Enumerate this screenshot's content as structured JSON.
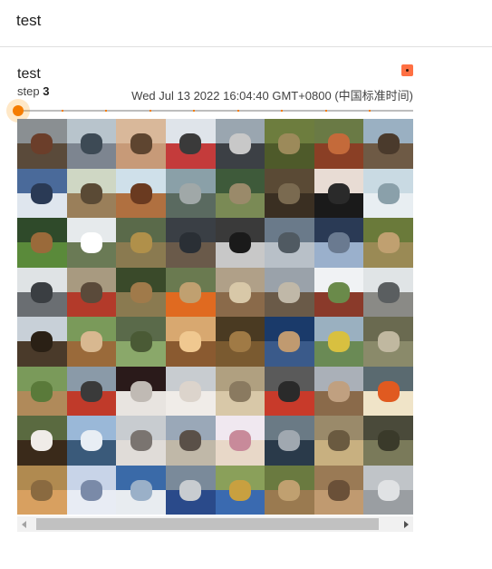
{
  "header": {
    "title": "test"
  },
  "card": {
    "title": "test",
    "step_label": "step",
    "step_value": "3",
    "timestamp": "Wed Jul 13 2022 16:04:40 GMT+0800 (中国标准时间)",
    "expand_icon": "expand-icon",
    "accent_color": "#ff7043"
  },
  "slider": {
    "value_fraction": 0.0,
    "thumb_color": "#f57c00",
    "ticks": 8
  },
  "image_grid": {
    "rows": 8,
    "cols": 8,
    "tiles": [
      [
        "#8a8f92",
        "#5a4a3a",
        "#6b3e2a"
      ],
      [
        "#b8c4cc",
        "#7d8590",
        "#3d4a55"
      ],
      [
        "#d9b89a",
        "#c79a78",
        "#5e4530"
      ],
      [
        "#dfe4ea",
        "#c43b3b",
        "#3a3a3a"
      ],
      [
        "#9aa6b0",
        "#3c4045",
        "#c8c8c8"
      ],
      [
        "#6d7d3e",
        "#4e5a2a",
        "#9c8a5a"
      ],
      [
        "#6a7a45",
        "#8a3f25",
        "#c46a3a"
      ],
      [
        "#9ab0c2",
        "#6e5a45",
        "#4a3a2c"
      ],
      [
        "#4a6a9a",
        "#dfe6ee",
        "#2a3a55"
      ],
      [
        "#cfd7c4",
        "#9a7f5a",
        "#5a4a35"
      ],
      [
        "#cfe0ea",
        "#b07040",
        "#6a3a20"
      ],
      [
        "#8aa0a8",
        "#5a6a60",
        "#a0a8a8"
      ],
      [
        "#3e5a3a",
        "#7a8a55",
        "#9a8a6a"
      ],
      [
        "#5a4a35",
        "#3a2f22",
        "#7a6a50"
      ],
      [
        "#e8dcd4",
        "#1a1a1a",
        "#2a2a2a"
      ],
      [
        "#c9dae3",
        "#e8eef2",
        "#8aa0aa"
      ],
      [
        "#2f4a2a",
        "#5a8a3a",
        "#9a6a3a"
      ],
      [
        "#e6eaec",
        "#6a7a55",
        "#ffffff"
      ],
      [
        "#5a6a4a",
        "#8a7a50",
        "#b0904a"
      ],
      [
        "#3a3f45",
        "#6a5a4a",
        "#2a2f35"
      ],
      [
        "#3a3a3a",
        "#c8c8c8",
        "#1a1a1a"
      ],
      [
        "#6a7a8a",
        "#b8c0c8",
        "#505a62"
      ],
      [
        "#2a3a55",
        "#9ab0cc",
        "#6a7a90"
      ],
      [
        "#6a7a3a",
        "#9a8a55",
        "#c0a070"
      ],
      [
        "#dfe3e5",
        "#6a6e72",
        "#3a3e42"
      ],
      [
        "#a89a80",
        "#b33a2a",
        "#5a4a3a"
      ],
      [
        "#3a4a2a",
        "#8a7a50",
        "#a07a4a"
      ],
      [
        "#6a7a50",
        "#e06a20",
        "#c0a070"
      ],
      [
        "#b0a088",
        "#8a6a4a",
        "#d8c8a8"
      ],
      [
        "#9aa2aa",
        "#6a5a48",
        "#c0b8a8"
      ],
      [
        "#f0f2f4",
        "#8a3a2a",
        "#6a8a4a"
      ],
      [
        "#e0e4e6",
        "#8a8a86",
        "#5a5e60"
      ],
      [
        "#c8d0d8",
        "#4a3a2a",
        "#2a2015"
      ],
      [
        "#7a9a5a",
        "#9a6a3a",
        "#d8b890"
      ],
      [
        "#5a6a4a",
        "#8aa86a",
        "#4a5a35"
      ],
      [
        "#d8a870",
        "#8a5a30",
        "#f0c890"
      ],
      [
        "#4a3a22",
        "#7a5a30",
        "#a07a45"
      ],
      [
        "#1a3a6a",
        "#3a5a8a",
        "#c09a70"
      ],
      [
        "#9ab0c0",
        "#6a8a55",
        "#d8c040"
      ],
      [
        "#6a6a50",
        "#8a8a6a",
        "#c0b8a0"
      ],
      [
        "#7a9a5a",
        "#b08a5a",
        "#5a7a3a"
      ],
      [
        "#8a9aa8",
        "#c03a2a",
        "#3a3a3a"
      ],
      [
        "#2a1a1a",
        "#e8e4e0",
        "#c0bab4"
      ],
      [
        "#c8ccd0",
        "#f0ece8",
        "#dcd4cc"
      ],
      [
        "#b0a080",
        "#d8c8a8",
        "#8a7a60"
      ],
      [
        "#5a5a5a",
        "#c83a2a",
        "#2a2a2a"
      ],
      [
        "#aab0b8",
        "#8a6a4a",
        "#c0a080"
      ],
      [
        "#5a6a70",
        "#f0e4c8",
        "#e05a20"
      ],
      [
        "#5a6a40",
        "#3a2a1a",
        "#f0ece8"
      ],
      [
        "#9ab8d8",
        "#3a5a7a",
        "#e8eef4"
      ],
      [
        "#c8ccd0",
        "#e0dcd8",
        "#7a7470"
      ],
      [
        "#9aa8b8",
        "#c0b8a8",
        "#5a5048"
      ],
      [
        "#f0e8f0",
        "#e8d8c8",
        "#c88a9a"
      ],
      [
        "#6a7a85",
        "#2a3a4a",
        "#a0a8b0"
      ],
      [
        "#9a8a6a",
        "#c8b080",
        "#6a5a40"
      ],
      [
        "#4a4a3a",
        "#7a7a5a",
        "#3a3a2a"
      ],
      [
        "#b08a50",
        "#d8a060",
        "#8a6a40"
      ],
      [
        "#c8d4e8",
        "#e8ecf4",
        "#7a8aa8"
      ],
      [
        "#3a6aa8",
        "#e8ecf0",
        "#9ab0c8"
      ],
      [
        "#7a8a9a",
        "#2a4a8a",
        "#c8ccd0"
      ],
      [
        "#8aa05a",
        "#3a6ab0",
        "#c8a040"
      ],
      [
        "#6a7a40",
        "#9a7a50",
        "#c0a070"
      ],
      [
        "#9a7a55",
        "#c09a70",
        "#6a5038"
      ],
      [
        "#c0c4c8",
        "#9a9ea2",
        "#e0e2e4"
      ]
    ]
  },
  "scrollbar": {
    "left_icon": "chevron-left-icon",
    "right_icon": "chevron-right-icon"
  }
}
